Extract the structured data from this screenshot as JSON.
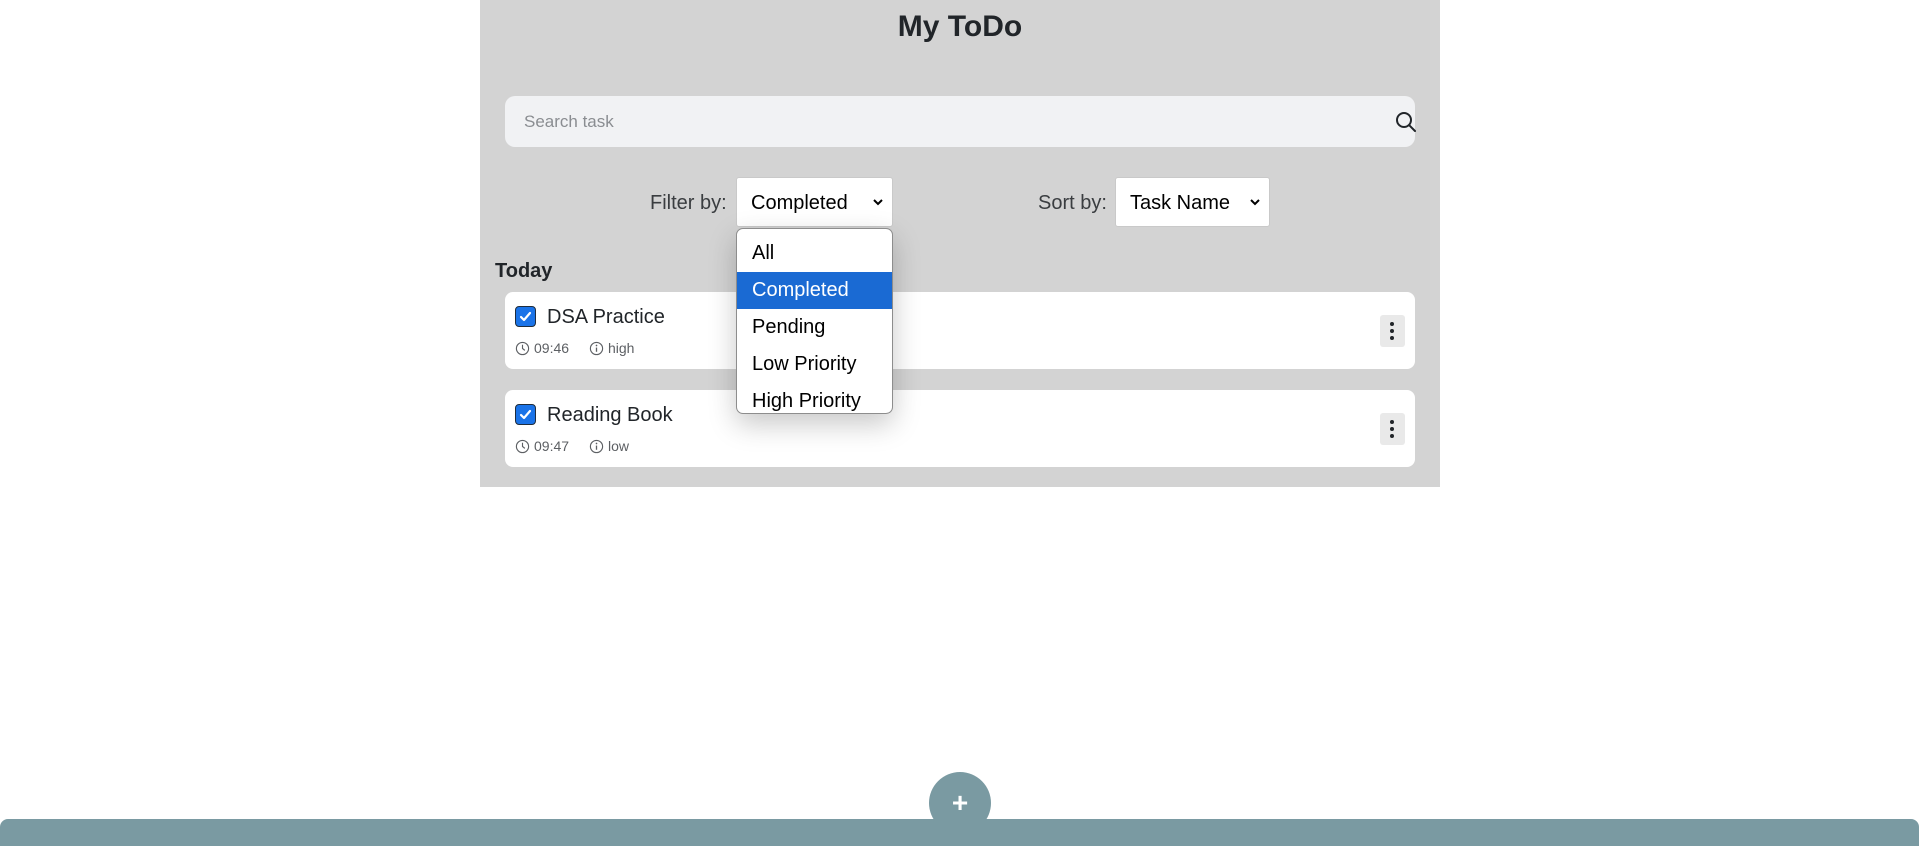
{
  "app": {
    "title": "My ToDo"
  },
  "search": {
    "placeholder": "Search task",
    "value": "",
    "icon": "search-icon"
  },
  "filter": {
    "label": "Filter by:",
    "selected": "Completed",
    "options": [
      "All",
      "Completed",
      "Pending",
      "Low Priority",
      "High Priority"
    ],
    "dropdown_open": true
  },
  "sort": {
    "label": "Sort by:",
    "selected": "Task Name"
  },
  "sections": [
    {
      "title": "Today",
      "tasks": [
        {
          "name": "DSA Practice",
          "time": "09:46",
          "priority": "high",
          "completed": true
        },
        {
          "name": "Reading Book",
          "time": "09:47",
          "priority": "low",
          "completed": true
        }
      ]
    }
  ],
  "fab": {
    "label": "+"
  },
  "colors": {
    "app_background": "#d3d3d3",
    "accent_blue": "#1a6ad3",
    "bottom_bar": "#7a9aa2",
    "card_background": "#ffffff"
  }
}
